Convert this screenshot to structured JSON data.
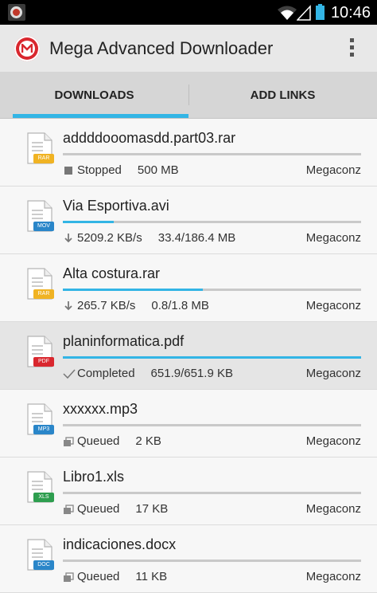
{
  "status_bar": {
    "time": "10:46"
  },
  "app": {
    "title": "Mega Advanced Downloader"
  },
  "tabs": [
    {
      "label": "DOWNLOADS",
      "selected": true
    },
    {
      "label": "ADD LINKS",
      "selected": false
    }
  ],
  "colors": {
    "accent": "#33b5e5",
    "brand_red": "#d9272e"
  },
  "downloads": [
    {
      "name": "addddooomasdd.part03.rar",
      "type": "RAR",
      "badge_color": "#f0b323",
      "progress": 0,
      "status_icon": "stop-icon",
      "status": "Stopped",
      "detail": "500 MB",
      "host": "Megaconz",
      "selected": false
    },
    {
      "name": "Via Esportiva.avi",
      "type": "MOV",
      "badge_color": "#2a86c9",
      "progress": 0.17,
      "status_icon": "download-arrow-icon",
      "status": "5209.2 KB/s",
      "detail": "33.4/186.4 MB",
      "host": "Megaconz",
      "selected": false
    },
    {
      "name": "Alta costura.rar",
      "type": "RAR",
      "badge_color": "#f0b323",
      "progress": 0.47,
      "status_icon": "download-arrow-icon",
      "status": "265.7 KB/s",
      "detail": "0.8/1.8 MB",
      "host": "Megaconz",
      "selected": false
    },
    {
      "name": "planinformatica.pdf",
      "type": "PDF",
      "badge_color": "#d9272e",
      "progress": 1.0,
      "status_icon": "check-icon",
      "status": "Completed",
      "detail": "651.9/651.9 KB",
      "host": "Megaconz",
      "selected": true
    },
    {
      "name": "xxxxxx.mp3",
      "type": "MP3",
      "badge_color": "#2a86c9",
      "progress": 0,
      "status_icon": "queue-icon",
      "status": "Queued",
      "detail": "2 KB",
      "host": "Megaconz",
      "selected": false
    },
    {
      "name": "Libro1.xls",
      "type": "XLS",
      "badge_color": "#2e9e4f",
      "progress": 0,
      "status_icon": "queue-icon",
      "status": "Queued",
      "detail": "17 KB",
      "host": "Megaconz",
      "selected": false
    },
    {
      "name": "indicaciones.docx",
      "type": "DOC",
      "badge_color": "#2a86c9",
      "progress": 0,
      "status_icon": "queue-icon",
      "status": "Queued",
      "detail": "11 KB",
      "host": "Megaconz",
      "selected": false
    }
  ]
}
